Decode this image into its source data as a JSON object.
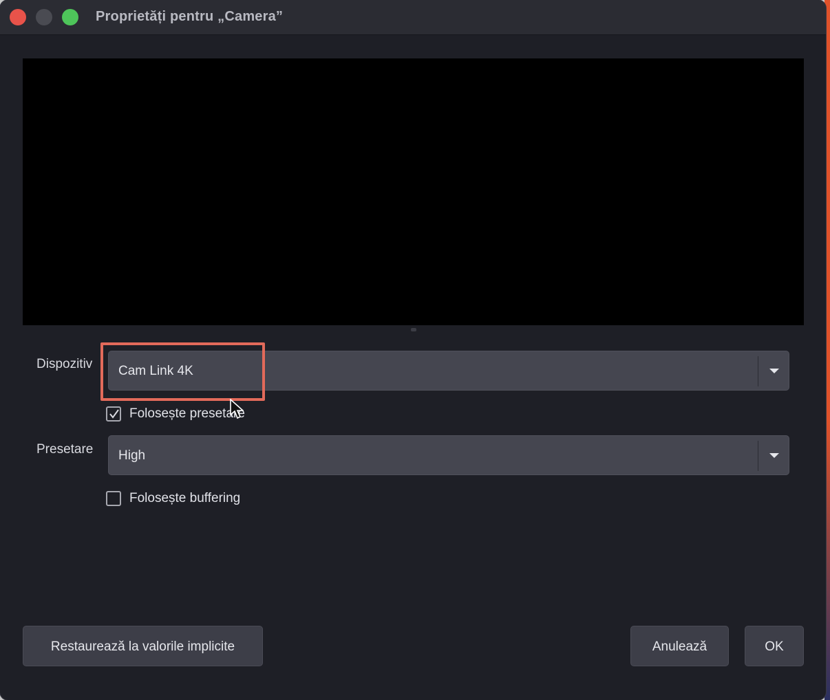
{
  "window": {
    "title": "Proprietăți pentru „Camera”"
  },
  "device": {
    "label": "Dispozitiv",
    "value": "Cam Link 4K"
  },
  "use_preset": {
    "label": "Folosește presetare",
    "checked": true
  },
  "preset": {
    "label": "Presetare",
    "value": "High"
  },
  "use_buffering": {
    "label": "Folosește buffering",
    "checked": false
  },
  "buttons": {
    "restore_label": "Restaurează la valorile implicite",
    "cancel_label": "Anulează",
    "ok_label": "OK"
  },
  "colors": {
    "background": "#1e1f26",
    "field": "#454650",
    "highlight": "#e26a5a"
  }
}
